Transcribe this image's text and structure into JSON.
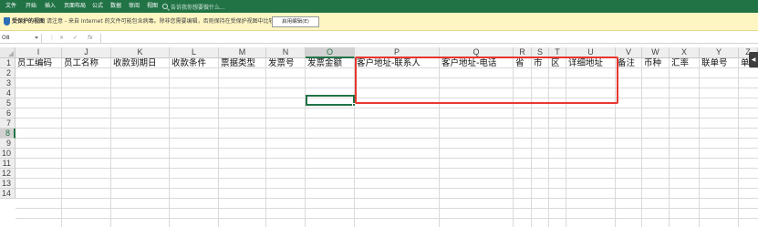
{
  "ribbon": {
    "tabs": [
      "文件",
      "开始",
      "插入",
      "页面布局",
      "公式",
      "数据",
      "审阅",
      "视图"
    ],
    "search_placeholder": "告诉我你想要做什么...",
    "colors": {
      "ribbon": "#217346"
    }
  },
  "protected_view": {
    "title": "受保护的视图",
    "message": "请注意 - 来自 Internet 的文件可能包含病毒。除非您需要编辑，否则保持在受保护视图中比较安全。",
    "enable_button": "启用编辑(E)",
    "icon": "shield-icon",
    "colors": {
      "bar": "#fdf6c3"
    }
  },
  "formula_bar": {
    "name_box": "O8",
    "separator": "⋮",
    "cancel_symbol": "×",
    "enter_symbol": "✓",
    "fx_symbol": "fx",
    "formula": ""
  },
  "grid": {
    "columns": [
      "I",
      "J",
      "K",
      "L",
      "M",
      "N",
      "O",
      "P",
      "Q",
      "R",
      "S",
      "T",
      "U",
      "V",
      "W",
      "X",
      "Y",
      "Z"
    ],
    "active_column": "O",
    "rows": [
      "1",
      "2",
      "3",
      "4",
      "5",
      "6",
      "7",
      "8",
      "9",
      "10",
      "11",
      "12",
      "13",
      "14"
    ],
    "active_row": "8",
    "active_cell": "O8",
    "row1_cells": [
      "员工编码",
      "员工名称",
      "收款到期日",
      "收款条件",
      "票据类型",
      "发票号",
      "发票金额",
      "客户地址-联系人",
      "客户地址-电话",
      "省",
      "市",
      "区",
      "详细地址",
      "备注",
      "币种",
      "汇率",
      "联单号",
      "单据"
    ],
    "selection_color": "#217346",
    "annotation_color": "#e8372f"
  }
}
